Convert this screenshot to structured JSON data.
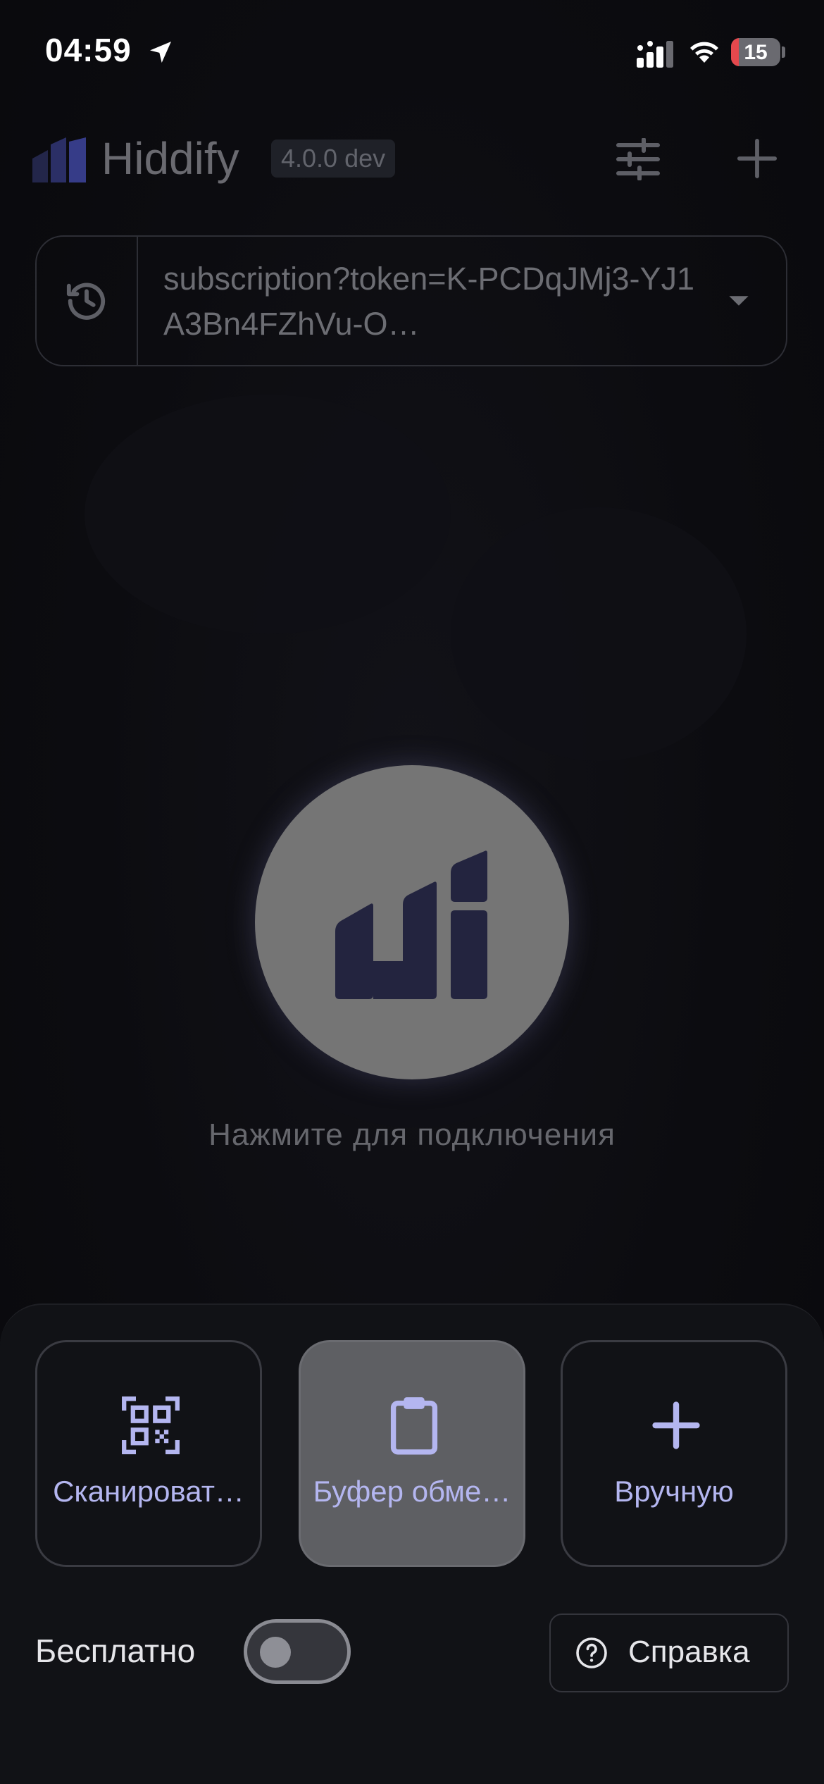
{
  "status_bar": {
    "time": "04:59",
    "battery_level": "15",
    "battery_fraction": 0.15,
    "battery_color": "#e5484d",
    "icons": [
      "location-arrow-icon",
      "cellular-signal-icon",
      "wifi-icon",
      "battery-icon"
    ]
  },
  "app_bar": {
    "title": "Hiddify",
    "version": "4.0.0 dev",
    "icons": [
      "hiddify-logo-icon",
      "settings-sliders-icon",
      "plus-icon"
    ]
  },
  "profile": {
    "name": "subscription?token=K-PCDqJMj3-YJ1A3Bn4FZhVu-O…",
    "icons": [
      "refresh-clock-icon",
      "dropdown-arrow-icon"
    ]
  },
  "connect": {
    "label": "Нажмите для подключения",
    "button_color": "#757575",
    "logo_color": "#23243f"
  },
  "actions": {
    "items": [
      {
        "label": "Сканироват…",
        "icon": "qr-code-icon"
      },
      {
        "label": "Буфер обме…",
        "icon": "clipboard-icon",
        "active": true
      },
      {
        "label": "Вручную",
        "icon": "plus-icon"
      }
    ]
  },
  "footer": {
    "free_label": "Бесплатно",
    "free_toggle_on": false,
    "help_label": "Справка",
    "help_icon": "help-circle-icon"
  },
  "colors": {
    "accent": "#b4b6f0",
    "background": "#0b0b0e",
    "sheet": "#111216"
  }
}
